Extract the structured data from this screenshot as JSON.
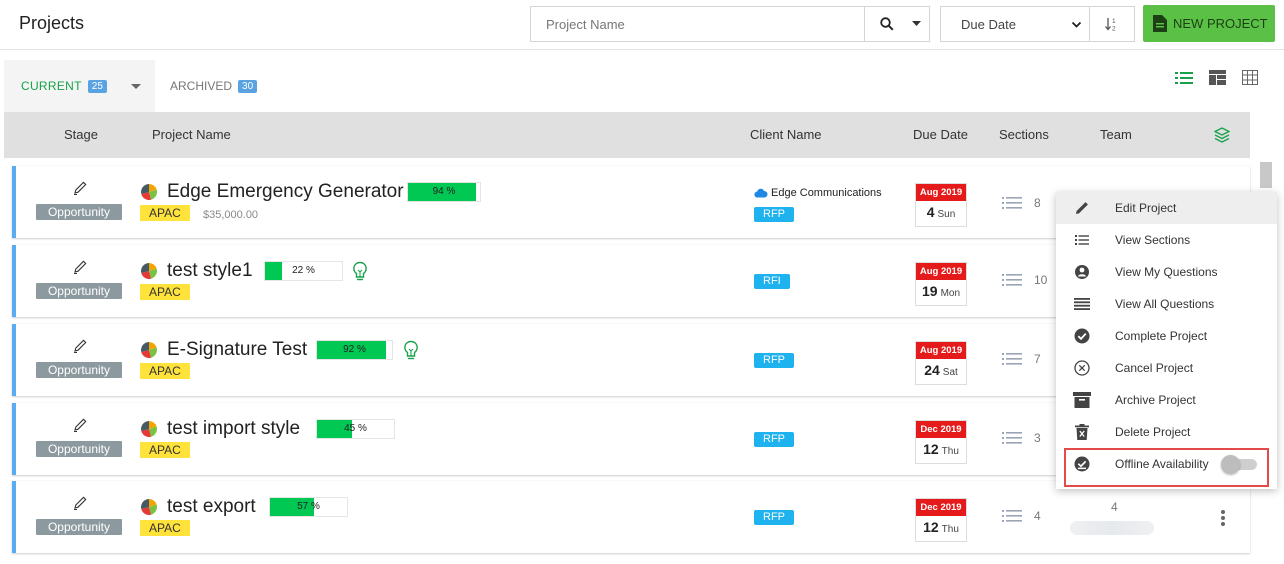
{
  "header": {
    "title": "Projects",
    "search_placeholder": "Project Name",
    "sort_by": "Due Date",
    "new_project_label": "NEW PROJECT"
  },
  "tabs": [
    {
      "label": "CURRENT",
      "count": "25",
      "active": true
    },
    {
      "label": "ARCHIVED",
      "count": "30",
      "active": false
    }
  ],
  "columns": [
    "Stage",
    "Project Name",
    "Client Name",
    "Due Date",
    "Sections",
    "Team"
  ],
  "rows": [
    {
      "name": "Edge Emergency Generator",
      "stage": "Opportunity",
      "region": "APAC",
      "amount": "$35,000.00",
      "progress": 94,
      "progress_label": "94 %",
      "client": "Edge Communications",
      "type": "RFP",
      "month": "Aug 2019",
      "day": "4",
      "dow": "Sun",
      "sections": "8",
      "team": ""
    },
    {
      "name": "test style1",
      "stage": "Opportunity",
      "region": "APAC",
      "amount": "",
      "progress": 22,
      "progress_label": "22 %",
      "client": "",
      "type": "RFI",
      "month": "Aug 2019",
      "day": "19",
      "dow": "Mon",
      "sections": "10",
      "team": ""
    },
    {
      "name": "E-Signature Test",
      "stage": "Opportunity",
      "region": "APAC",
      "amount": "",
      "progress": 92,
      "progress_label": "92 %",
      "client": "",
      "type": "RFP",
      "month": "Aug 2019",
      "day": "24",
      "dow": "Sat",
      "sections": "7",
      "team": ""
    },
    {
      "name": "test import style",
      "stage": "Opportunity",
      "region": "APAC",
      "amount": "",
      "progress": 45,
      "progress_label": "45 %",
      "client": "",
      "type": "RFP",
      "month": "Dec 2019",
      "day": "12",
      "dow": "Thu",
      "sections": "3",
      "team": ""
    },
    {
      "name": "test export",
      "stage": "Opportunity",
      "region": "APAC",
      "amount": "",
      "progress": 57,
      "progress_label": "57 %",
      "client": "",
      "type": "RFP",
      "month": "Dec 2019",
      "day": "12",
      "dow": "Thu",
      "sections": "4",
      "team": "4"
    }
  ],
  "context_menu": {
    "items": [
      "Edit Project",
      "View Sections",
      "View My Questions",
      "View All Questions",
      "Complete Project",
      "Cancel Project",
      "Archive Project",
      "Delete Project",
      "Offline Availability"
    ],
    "offline_enabled": false
  },
  "colors": {
    "accent_green": "#18a14b",
    "new_button": "#5bc146",
    "progress_fill": "#00c853",
    "row_border": "#5aacf0",
    "date_red": "#e51b1b",
    "type_badge": "#1eb2ee",
    "region_badge": "#ffe23a"
  }
}
